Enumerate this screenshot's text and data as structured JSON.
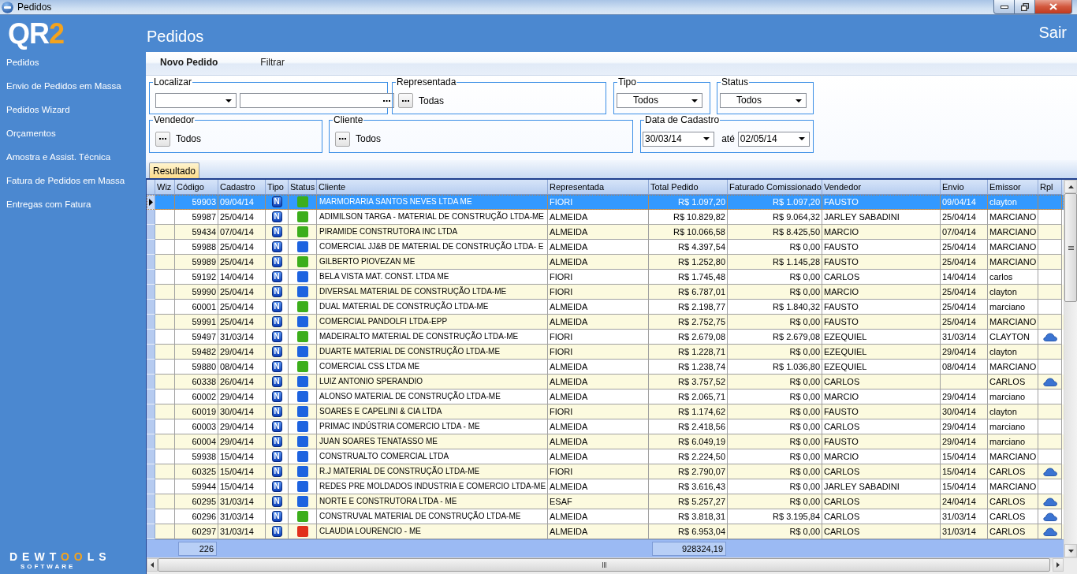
{
  "window": {
    "title": "Pedidos"
  },
  "logo": {
    "main": "QR",
    "accent": "2"
  },
  "sidebar": {
    "items": [
      "Pedidos",
      "Envio de Pedidos em Massa",
      "Pedidos Wizard",
      "Orçamentos",
      "Amostra e Assist. Técnica",
      "Fatura de Pedidos em Massa",
      "Entregas com Fatura"
    ]
  },
  "brand": {
    "start": "DEWT",
    "accent": "OO",
    "end": "LS",
    "tagline": "SOFTWARE"
  },
  "header": {
    "title": "Pedidos",
    "exit": "Sair"
  },
  "toolbar": [
    {
      "label": "Novo Pedido",
      "kind": "primary"
    },
    {
      "label": "Filtrar",
      "kind": "plain"
    }
  ],
  "filter_rows": [
    {
      "groups": [
        {
          "legend": "Localizar",
          "controls": [
            {
              "kind": "dropdown"
            },
            {
              "kind": "browse_field"
            }
          ]
        },
        {
          "legend": "Representada",
          "controls": [
            {
              "kind": "lookup",
              "value": "Todas"
            }
          ]
        },
        {
          "legend": "Tipo",
          "controls": [
            {
              "kind": "dropdown",
              "value": "Todos"
            }
          ]
        },
        {
          "legend": "Status",
          "controls": [
            {
              "kind": "dropdown",
              "value": "Todos"
            }
          ]
        }
      ]
    },
    {
      "groups": [
        {
          "legend": "Vendedor",
          "controls": [
            {
              "kind": "lookup",
              "value": "Todos"
            }
          ]
        },
        {
          "legend": "Cliente",
          "controls": [
            {
              "kind": "lookup",
              "value": "Todos"
            }
          ]
        },
        {
          "legend": "Data de Cadastro",
          "controls": [
            {
              "kind": "date",
              "value": "30/03/14"
            },
            {
              "kind": "label",
              "value": "até"
            },
            {
              "kind": "date",
              "value": "02/05/14"
            }
          ]
        }
      ]
    }
  ],
  "tabs": [
    {
      "label": "Resultado",
      "selected": true
    }
  ],
  "table": {
    "columns": [
      "Wiz",
      "Código",
      "Cadastro",
      "Tipo",
      "Status",
      "Cliente",
      "Representada",
      "Total Pedido",
      "Faturado Comissionado",
      "Vendedor",
      "Envio",
      "Emissor",
      "Rpl"
    ],
    "rows": [
      {
        "selected": true,
        "code": "59903",
        "date": "09/04/14",
        "type": "N",
        "color": "#3cae1c",
        "client": "MARMORARIA SANTOS NEVES LTDA ME",
        "company": "FIORI",
        "total": "R$ 1.097,20",
        "invoiced": "R$ 1.097,20",
        "seller": "FAUSTO",
        "sent": "09/04/14",
        "issuer": "clayton",
        "rpl": false
      },
      {
        "selected": false,
        "code": "59987",
        "date": "25/04/14",
        "type": "N",
        "color": "#3cae1c",
        "client": "ADIMILSON TARGA - MATERIAL DE CONSTRUÇÃO LTDA-ME",
        "company": "ALMEIDA",
        "total": "R$ 10.829,82",
        "invoiced": "R$ 9.064,32",
        "seller": "JARLEY SABADINI",
        "sent": "25/04/14",
        "issuer": "MARCIANO",
        "rpl": false
      },
      {
        "selected": false,
        "code": "59434",
        "date": "07/04/14",
        "type": "N",
        "color": "#3cae1c",
        "client": "PIRAMIDE CONSTRUTORA INC LTDA",
        "company": "ALMEIDA",
        "total": "R$ 10.066,58",
        "invoiced": "R$ 8.425,50",
        "seller": "MARCIO",
        "sent": "07/04/14",
        "issuer": "MARCIANO",
        "rpl": false
      },
      {
        "selected": false,
        "code": "59988",
        "date": "25/04/14",
        "type": "N",
        "color": "#1d63e0",
        "client": "COMERCIAL JJ&B DE MATERIAL DE CONSTRUÇÃO LTDA- E",
        "company": "ALMEIDA",
        "total": "R$ 4.397,54",
        "invoiced": "R$ 0,00",
        "seller": "FAUSTO",
        "sent": "25/04/14",
        "issuer": "MARCIANO",
        "rpl": false
      },
      {
        "selected": false,
        "code": "59989",
        "date": "25/04/14",
        "type": "N",
        "color": "#3cae1c",
        "client": "GILBERTO PIOVEZAN ME",
        "company": "ALMEIDA",
        "total": "R$ 1.252,80",
        "invoiced": "R$ 1.145,28",
        "seller": "FAUSTO",
        "sent": "25/04/14",
        "issuer": "MARCIANO",
        "rpl": false
      },
      {
        "selected": false,
        "code": "59192",
        "date": "14/04/14",
        "type": "N",
        "color": "#1d63e0",
        "client": "BELA VISTA MAT. CONST. LTDA ME",
        "company": "FIORI",
        "total": "R$ 1.745,48",
        "invoiced": "R$ 0,00",
        "seller": "CARLOS",
        "sent": "14/04/14",
        "issuer": "carlos",
        "rpl": false
      },
      {
        "selected": false,
        "code": "59990",
        "date": "25/04/14",
        "type": "N",
        "color": "#1d63e0",
        "client": "DIVERSAL MATERIAL DE CONSTRUÇÃO LTDA-ME",
        "company": "FIORI",
        "total": "R$ 6.787,01",
        "invoiced": "R$ 0,00",
        "seller": "MARCIO",
        "sent": "25/04/14",
        "issuer": "clayton",
        "rpl": false
      },
      {
        "selected": false,
        "code": "60001",
        "date": "25/04/14",
        "type": "N",
        "color": "#3cae1c",
        "client": "DUAL MATERIAL DE CONSTRUÇÃO LTDA-ME",
        "company": "ALMEIDA",
        "total": "R$ 2.198,77",
        "invoiced": "R$ 1.840,32",
        "seller": "FAUSTO",
        "sent": "25/04/14",
        "issuer": "marciano",
        "rpl": false
      },
      {
        "selected": false,
        "code": "59991",
        "date": "25/04/14",
        "type": "N",
        "color": "#1d63e0",
        "client": "COMERCIAL PANDOLFI LTDA-EPP",
        "company": "ALMEIDA",
        "total": "R$ 2.752,75",
        "invoiced": "R$ 0,00",
        "seller": "FAUSTO",
        "sent": "25/04/14",
        "issuer": "MARCIANO",
        "rpl": false
      },
      {
        "selected": false,
        "code": "59497",
        "date": "31/03/14",
        "type": "N",
        "color": "#3cae1c",
        "client": "MADEIRALTO MATERIAL DE CONSTRUÇÃO LTDA-ME",
        "company": "FIORI",
        "total": "R$ 2.679,08",
        "invoiced": "R$ 2.679,08",
        "seller": "EZEQUIEL",
        "sent": "31/03/14",
        "issuer": "CLAYTON",
        "rpl": true
      },
      {
        "selected": false,
        "code": "59482",
        "date": "29/04/14",
        "type": "N",
        "color": "#1d63e0",
        "client": "DUARTE MATERIAL DE CONSTRUÇÃO LTDA-ME",
        "company": "FIORI",
        "total": "R$ 1.228,71",
        "invoiced": "R$ 0,00",
        "seller": "EZEQUIEL",
        "sent": "29/04/14",
        "issuer": "clayton",
        "rpl": false
      },
      {
        "selected": false,
        "code": "59880",
        "date": "08/04/14",
        "type": "N",
        "color": "#3cae1c",
        "client": "COMERCIAL CSS LTDA ME",
        "company": "ALMEIDA",
        "total": "R$ 1.238,74",
        "invoiced": "R$ 1.036,80",
        "seller": "EZEQUIEL",
        "sent": "08/04/14",
        "issuer": "MARCIANO",
        "rpl": false
      },
      {
        "selected": false,
        "code": "60338",
        "date": "26/04/14",
        "type": "N",
        "color": "#1d63e0",
        "client": "LUIZ ANTONIO SPERANDIO",
        "company": "ALMEIDA",
        "total": "R$ 3.757,52",
        "invoiced": "R$ 0,00",
        "seller": "CARLOS",
        "issuer": "CARLOS",
        "rpl": true
      },
      {
        "selected": false,
        "code": "60002",
        "date": "29/04/14",
        "type": "N",
        "color": "#1d63e0",
        "client": "ALONSO MATERIAL DE CONSTRUÇÃO LTDA-ME",
        "company": "ALMEIDA",
        "total": "R$ 2.065,71",
        "invoiced": "R$ 0,00",
        "seller": "MARCIO",
        "sent": "29/04/14",
        "issuer": "marciano",
        "rpl": false
      },
      {
        "selected": false,
        "code": "60019",
        "date": "30/04/14",
        "type": "N",
        "color": "#1d63e0",
        "client": "SOARES E CAPELINI & CIA LTDA",
        "company": "FIORI",
        "total": "R$ 1.174,62",
        "invoiced": "R$ 0,00",
        "seller": "FAUSTO",
        "sent": "30/04/14",
        "issuer": "clayton",
        "rpl": false
      },
      {
        "selected": false,
        "code": "60003",
        "date": "29/04/14",
        "type": "N",
        "color": "#1d63e0",
        "client": "PRIMAC INDÚSTRIA COMERCIO LTDA - ME",
        "company": "ALMEIDA",
        "total": "R$ 2.418,56",
        "invoiced": "R$ 0,00",
        "seller": "CARLOS",
        "sent": "29/04/14",
        "issuer": "marciano",
        "rpl": false
      },
      {
        "selected": false,
        "code": "60004",
        "date": "29/04/14",
        "type": "N",
        "color": "#1d63e0",
        "client": "JUAN SOARES TENATASSO ME",
        "company": "ALMEIDA",
        "total": "R$ 6.049,19",
        "invoiced": "R$ 0,00",
        "seller": "FAUSTO",
        "sent": "29/04/14",
        "issuer": "marciano",
        "rpl": false
      },
      {
        "selected": false,
        "code": "59938",
        "date": "15/04/14",
        "type": "N",
        "color": "#1d63e0",
        "client": "CONSTRUALTO COMERCIAL LTDA",
        "company": "ALMEIDA",
        "total": "R$ 2.224,50",
        "invoiced": "R$ 0,00",
        "seller": "MARCIO",
        "sent": "15/04/14",
        "issuer": "MARCIANO",
        "rpl": false
      },
      {
        "selected": false,
        "code": "60325",
        "date": "15/04/14",
        "type": "N",
        "color": "#1d63e0",
        "client": "R.J MATERIAL DE CONSTRUÇÃO LTDA-ME",
        "company": "FIORI",
        "total": "R$ 2.790,07",
        "invoiced": "R$ 0,00",
        "seller": "CARLOS",
        "sent": "15/04/14",
        "issuer": "CARLOS",
        "rpl": true
      },
      {
        "selected": false,
        "code": "59944",
        "date": "15/04/14",
        "type": "N",
        "color": "#1d63e0",
        "client": "REDES PRE MOLDADOS INDUSTRIA E COMERCIO LTDA-ME",
        "company": "ALMEIDA",
        "total": "R$ 3.616,43",
        "invoiced": "R$ 0,00",
        "seller": "JARLEY SABADINI",
        "sent": "15/04/14",
        "issuer": "MARCIANO",
        "rpl": false
      },
      {
        "selected": false,
        "code": "60295",
        "date": "31/03/14",
        "type": "N",
        "color": "#1d63e0",
        "client": "NORTE E CONSTRUTORA LTDA - ME",
        "company": "ESAF",
        "total": "R$ 5.257,27",
        "invoiced": "R$ 0,00",
        "seller": "CARLOS",
        "sent": "24/04/14",
        "issuer": "CARLOS",
        "rpl": true
      },
      {
        "selected": false,
        "code": "60296",
        "date": "31/03/14",
        "type": "N",
        "color": "#3cae1c",
        "client": "CONSTRUVAL MATERIAL DE CONSTRUÇÃO LTDA-ME",
        "company": "ALMEIDA",
        "total": "R$ 3.818,31",
        "invoiced": "R$ 3.195,84",
        "seller": "CARLOS",
        "sent": "31/03/14",
        "issuer": "CARLOS",
        "rpl": true
      },
      {
        "selected": false,
        "code": "60297",
        "date": "31/03/14",
        "type": "N",
        "color": "#e1301c",
        "client": "CLAUDIA LOURENCIO - ME",
        "company": "ALMEIDA",
        "total": "R$ 6.953,04",
        "invoiced": "R$ 0,00",
        "seller": "CARLOS",
        "sent": "31/03/14",
        "issuer": "CARLOS",
        "rpl": true
      }
    ],
    "totals": {
      "count": "226",
      "total": "928324,19"
    }
  }
}
